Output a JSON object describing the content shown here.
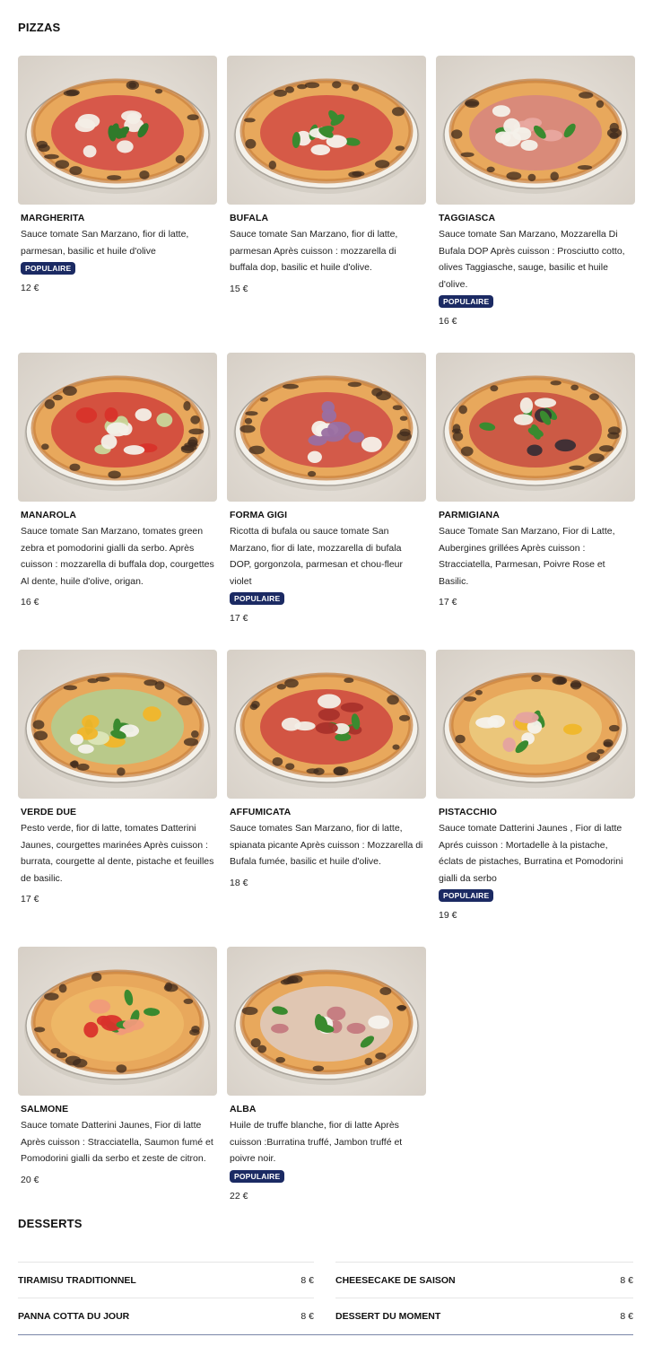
{
  "pizzas_title": "PIZZAS",
  "desserts_title": "DESSERTS",
  "pizzas": [
    {
      "name": "MARGHERITA",
      "desc": "Sauce tomate San Marzano, fior di latte, parmesan, basilic et huile d'olive",
      "badge": "POPULAIRE",
      "price": "12 €",
      "style": "marg"
    },
    {
      "name": "BUFALA",
      "desc": "Sauce tomate San Marzano, fior di latte, parmesan Après cuisson : mozzarella di buffala dop, basilic et huile d'olive.",
      "badge": "",
      "price": "15 €",
      "style": "bufala"
    },
    {
      "name": "TAGGIASCA",
      "desc": "Sauce tomate San Marzano, Mozzarella Di Bufala DOP Après cuisson : Prosciutto cotto, olives Taggiasche, sauge, basilic et huile d'olive.",
      "badge": "POPULAIRE",
      "price": "16 €",
      "style": "taggiasca"
    },
    {
      "name": "MANAROLA",
      "desc": "Sauce tomate San Marzano, tomates green zebra et pomodorini gialli da serbo. Après cuisson : mozzarella di buffala dop, courgettes Al dente, huile d'olive, origan.",
      "badge": "",
      "price": "16 €",
      "style": "manarola"
    },
    {
      "name": "FORMA GIGI",
      "desc": "Ricotta di bufala ou sauce tomate San Marzano, fior di late, mozzarella di bufala DOP, gorgonzola, parmesan et chou-fleur violet",
      "badge": "POPULAIRE",
      "price": "17 €",
      "style": "gigi"
    },
    {
      "name": "PARMIGIANA",
      "desc": "Sauce Tomate San Marzano, Fior di Latte, Aubergines grillées Après cuisson : Stracciatella, Parmesan, Poivre Rose et Basilic.",
      "badge": "",
      "price": "17 €",
      "style": "parmigiana"
    },
    {
      "name": "VERDE DUE",
      "desc": "Pesto verde, fior di latte, tomates Datterini Jaunes, courgettes marinées Après cuisson : burrata, courgette al dente, pistache et feuilles de basilic.",
      "badge": "",
      "price": "17 €",
      "style": "verde"
    },
    {
      "name": "AFFUMICATA",
      "desc": "Sauce tomates San Marzano, fior di latte, spianata picante Après cuisson : Mozzarella di Bufala fumée, basilic et huile d'olive.",
      "badge": "",
      "price": "18 €",
      "style": "affumicata"
    },
    {
      "name": "PISTACCHIO",
      "desc": "Sauce tomate Datterini Jaunes , Fior di latte Aprés cuisson : Mortadelle à la pistache, éclats de pistaches, Burratina et Pomodorini gialli da serbo",
      "badge": "POPULAIRE",
      "price": "19 €",
      "style": "pistacchio"
    },
    {
      "name": "SALMONE",
      "desc": "Sauce tomate Datterini Jaunes, Fior di latte Après cuisson : Stracciatella, Saumon fumé et Pomodorini gialli da serbo et zeste de citron.",
      "badge": "",
      "price": "20 €",
      "style": "salmone"
    },
    {
      "name": "ALBA",
      "desc": "Huile de truffe blanche, fior di latte Après cuisson :Burratina truffé, Jambon truffé et poivre noir.",
      "badge": "POPULAIRE",
      "price": "22 €",
      "style": "alba"
    }
  ],
  "desserts": [
    {
      "name": "TIRAMISU TRADITIONNEL",
      "price": "8 €"
    },
    {
      "name": "CHEESECAKE DE SAISON",
      "price": "8 €"
    },
    {
      "name": "PANNA COTTA DU JOUR",
      "price": "8 €"
    },
    {
      "name": "DESSERT DU MOMENT",
      "price": "8 €"
    }
  ]
}
